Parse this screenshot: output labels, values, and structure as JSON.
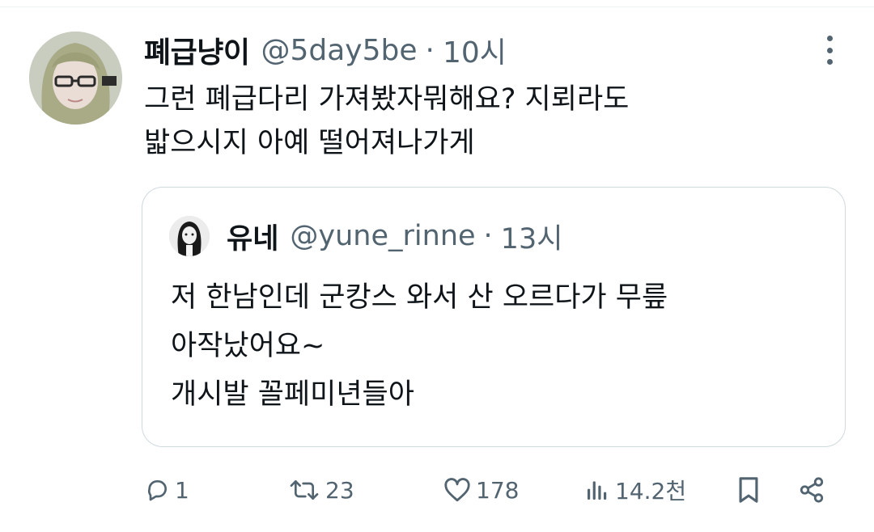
{
  "tweet": {
    "author_name": "폐급냥이",
    "author_handle": "@5day5be",
    "separator": "·",
    "time": "10시",
    "text_lines": [
      "그런 폐급다리 가져봤자뭐해요? 지뢰라도",
      "밟으시지 아예 떨어져나가게"
    ]
  },
  "quoted_tweet": {
    "author_name": "유네",
    "author_handle": "@yune_rinne",
    "separator": "·",
    "time": "13시",
    "text_lines": [
      "저 한남인데 군캉스 와서 산 오르다가 무릎",
      "아작났어요~",
      "개시발 꼴페미년들아"
    ]
  },
  "actions": {
    "reply_count": "1",
    "retweet_count": "23",
    "like_count": "178",
    "views_count": "14.2천"
  },
  "icons": {
    "reply": "reply-icon",
    "retweet": "retweet-icon",
    "like": "heart-icon",
    "views": "views-icon",
    "bookmark": "bookmark-icon",
    "share": "share-icon",
    "more": "more-vertical-icon"
  },
  "colors": {
    "text": "#0f1419",
    "secondary": "#536471",
    "border": "#cfd9de"
  }
}
